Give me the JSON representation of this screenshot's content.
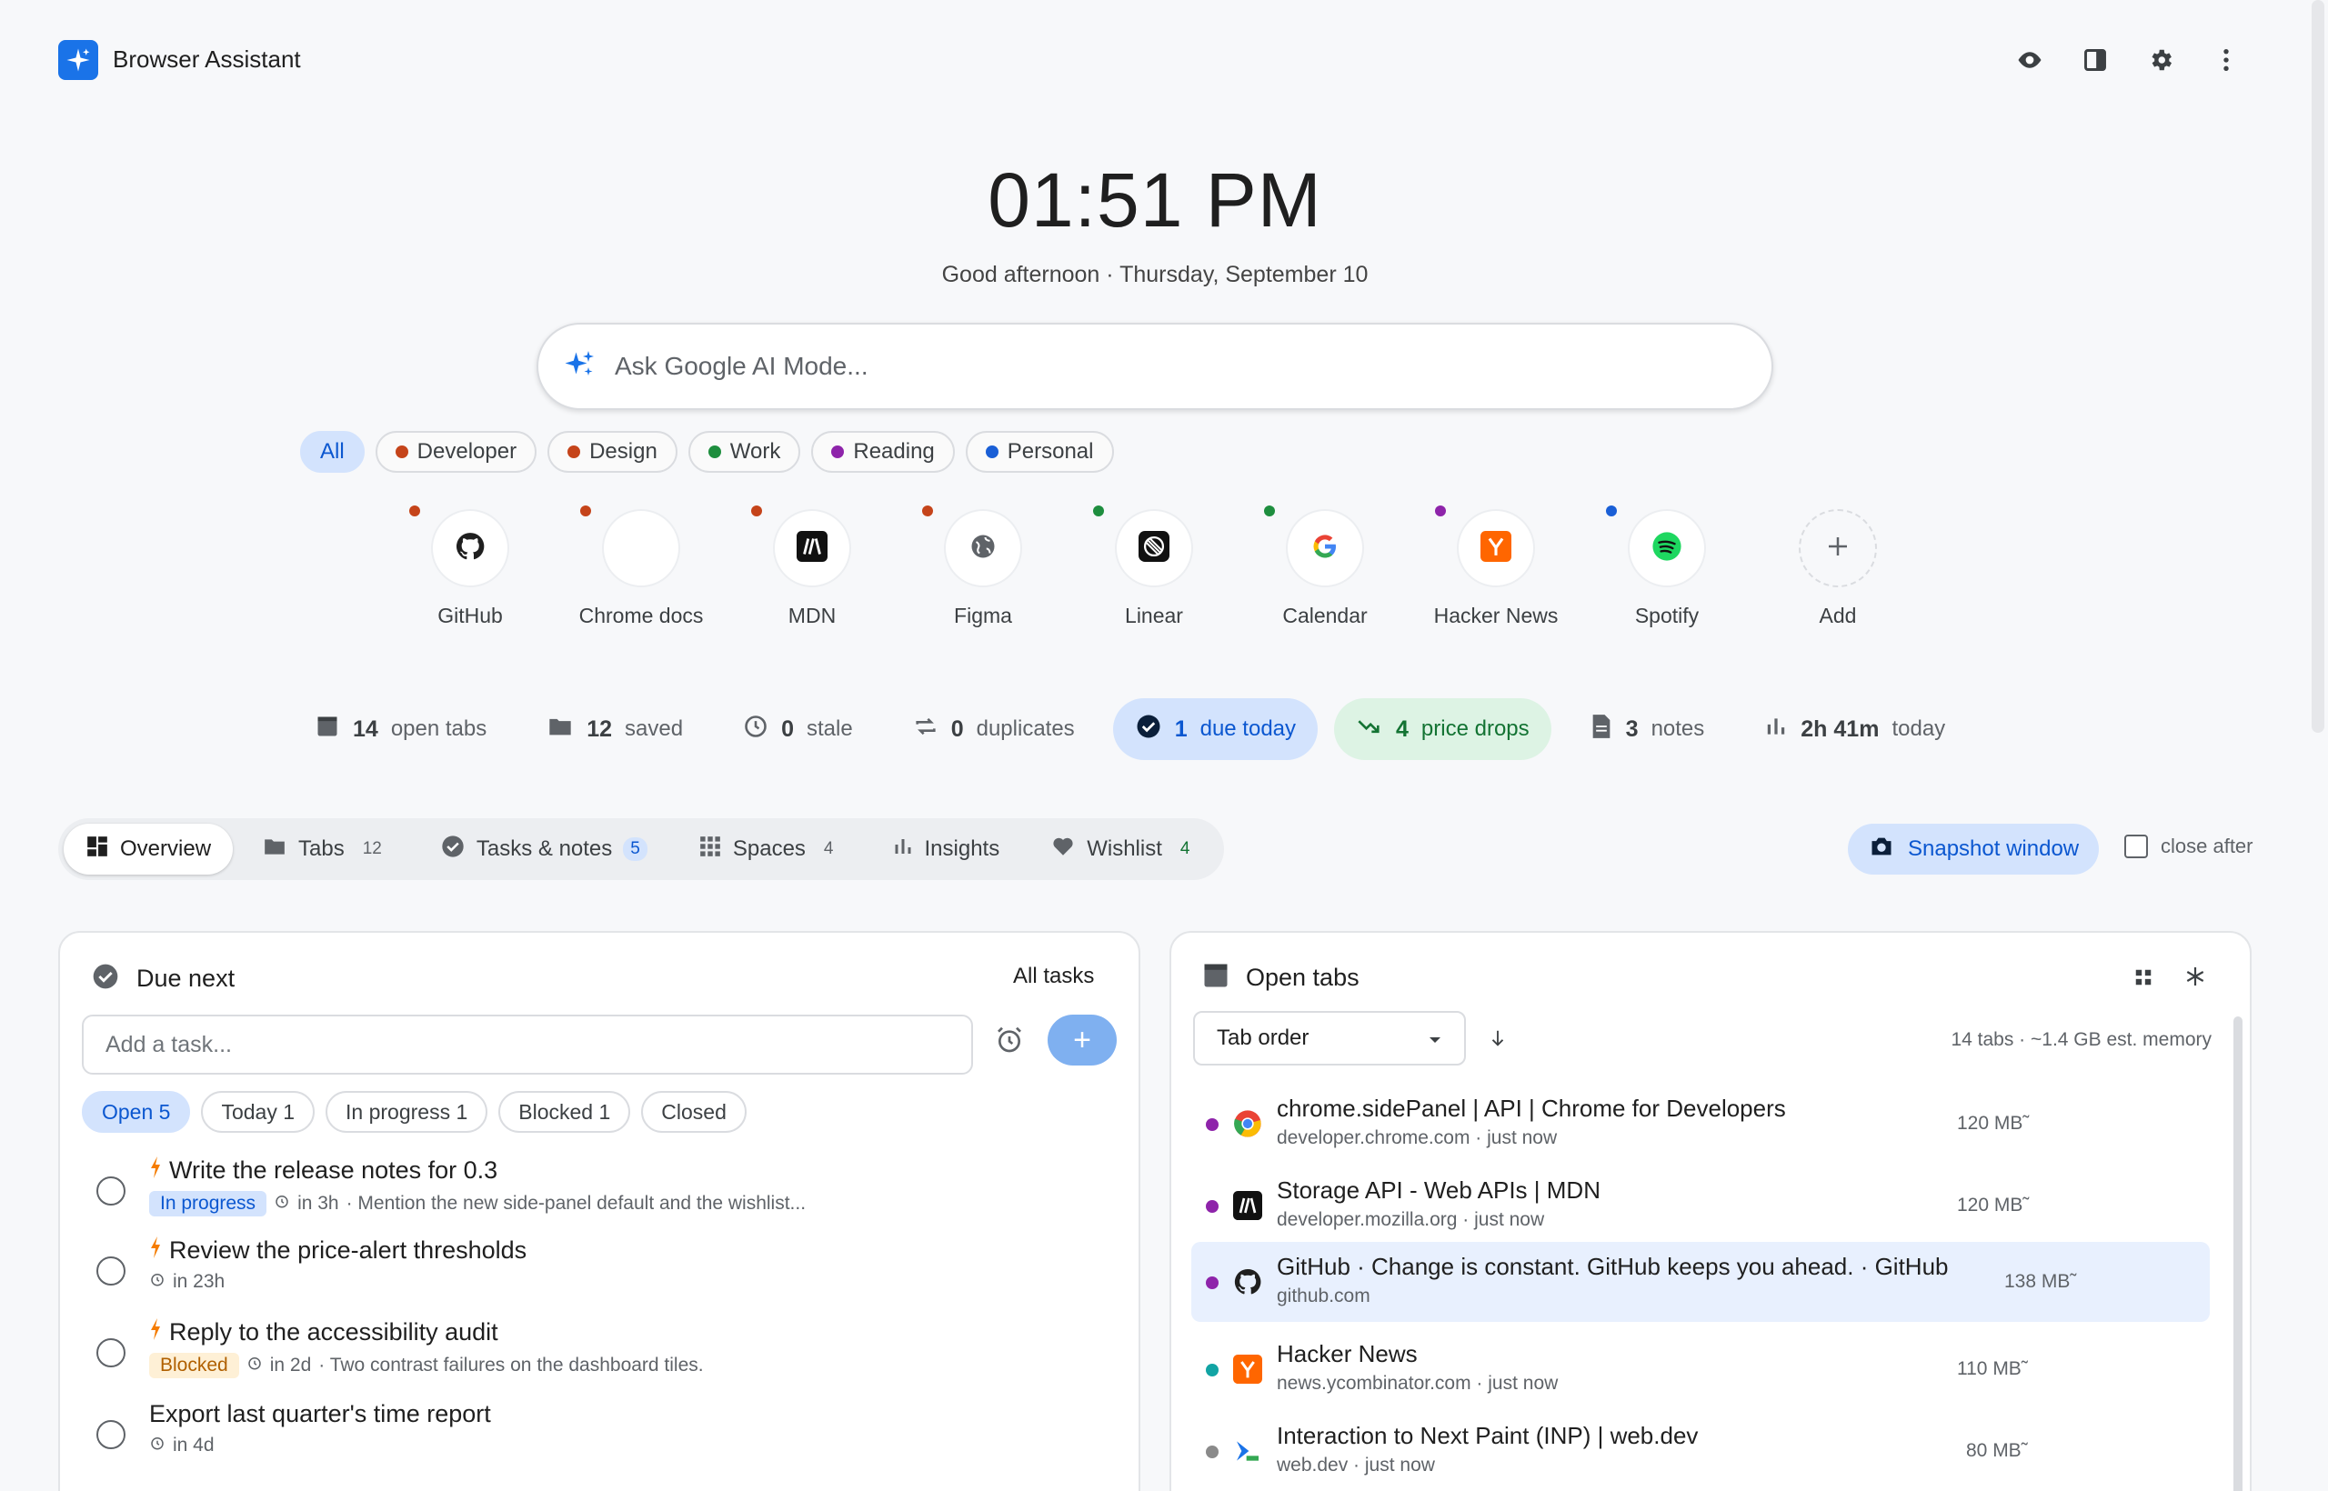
{
  "header": {
    "app_title": "Browser Assistant"
  },
  "clock": {
    "time": "01:51 PM",
    "greeting": "Good afternoon · Thursday, September 10"
  },
  "search": {
    "placeholder": "Ask Google AI Mode..."
  },
  "categories": [
    {
      "label": "All",
      "color": ""
    },
    {
      "label": "Developer",
      "color": "#c5441a"
    },
    {
      "label": "Design",
      "color": "#c5441a"
    },
    {
      "label": "Work",
      "color": "#1e8e3e"
    },
    {
      "label": "Reading",
      "color": "#8e24aa"
    },
    {
      "label": "Personal",
      "color": "#1a5fd6"
    }
  ],
  "shortcuts": [
    {
      "label": "GitHub",
      "icon": "github-icon",
      "color": "#c5441a"
    },
    {
      "label": "Chrome docs",
      "icon": "blank-icon",
      "color": "#c5441a"
    },
    {
      "label": "MDN",
      "icon": "mdn-icon",
      "color": "#c5441a"
    },
    {
      "label": "Figma",
      "icon": "globe-icon",
      "color": "#c5441a"
    },
    {
      "label": "Linear",
      "icon": "linear-icon",
      "color": "#1e8e3e"
    },
    {
      "label": "Calendar",
      "icon": "google-icon",
      "color": "#1e8e3e"
    },
    {
      "label": "Hacker News",
      "icon": "hn-icon",
      "color": "#8e24aa"
    },
    {
      "label": "Spotify",
      "icon": "spotify-icon",
      "color": "#1a5fd6"
    },
    {
      "label": "Add",
      "icon": "plus-icon",
      "color": ""
    }
  ],
  "stats": {
    "open_tabs": {
      "value": "14",
      "label": "open tabs"
    },
    "saved": {
      "value": "12",
      "label": "saved"
    },
    "stale": {
      "value": "0",
      "label": "stale"
    },
    "duplicates": {
      "value": "0",
      "label": "duplicates"
    },
    "due_today": {
      "value": "1",
      "label": "due today"
    },
    "price_drops": {
      "value": "4",
      "label": "price drops"
    },
    "notes": {
      "value": "3",
      "label": "notes"
    },
    "time": {
      "value": "2h 41m",
      "label": "today"
    }
  },
  "nav_tabs": {
    "overview": "Overview",
    "tabs": {
      "label": "Tabs",
      "count": "12"
    },
    "tasks": {
      "label": "Tasks & notes",
      "count": "5"
    },
    "spaces": {
      "label": "Spaces",
      "count": "4"
    },
    "insights": "Insights",
    "wishlist": {
      "label": "Wishlist",
      "count": "4"
    }
  },
  "snapshot": {
    "label": "Snapshot window",
    "close_after": "close after"
  },
  "due_next": {
    "title": "Due next",
    "all_tasks": "All tasks",
    "input_placeholder": "Add a task...",
    "filters": [
      "Open 5",
      "Today 1",
      "In progress 1",
      "Blocked 1",
      "Closed"
    ],
    "tasks": [
      {
        "title": "Write the release notes for 0.3",
        "status": "In progress",
        "due": "in 3h",
        "note": "· Mention the new side-panel default and the wishlist..."
      },
      {
        "title": "Review the price-alert thresholds",
        "status": "",
        "due": "in 23h",
        "note": ""
      },
      {
        "title": "Reply to the accessibility audit",
        "status": "Blocked",
        "due": "in 2d",
        "note": "· Two contrast failures on the dashboard tiles."
      },
      {
        "title": "Export last quarter's time report",
        "status": "",
        "due": "in 4d",
        "note": ""
      }
    ]
  },
  "open_tabs": {
    "title": "Open tabs",
    "sort": "Tab order",
    "summary": "14 tabs · ~1.4 GB est. memory",
    "rows": [
      {
        "title": "chrome.sidePanel  |  API  |  Chrome for Developers",
        "sub": "developer.chrome.com · just now",
        "mem": "120 MB˜",
        "dot": "#8e24aa",
        "icon": "chrome-icon"
      },
      {
        "title": "Storage API - Web APIs | MDN",
        "sub": "developer.mozilla.org · just now",
        "mem": "120 MB˜",
        "dot": "#8e24aa",
        "icon": "mdn-icon"
      },
      {
        "title": "GitHub · Change is constant. GitHub keeps you ahead. · GitHub",
        "sub": "github.com",
        "mem": "138 MB˜",
        "dot": "#8e24aa",
        "icon": "github-icon"
      },
      {
        "title": "Hacker News",
        "sub": "news.ycombinator.com · just now",
        "mem": "110 MB˜",
        "dot": "#12a4a4",
        "icon": "hn-icon"
      },
      {
        "title": "Interaction to Next Paint (INP)  |  web.dev",
        "sub": "web.dev · just now",
        "mem": "80 MB˜",
        "dot": "#8a8a8a",
        "icon": "webdev-icon"
      }
    ]
  }
}
